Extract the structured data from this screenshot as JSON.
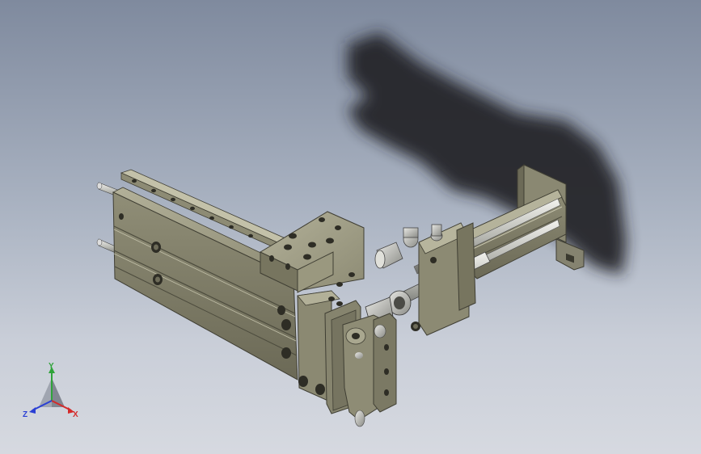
{
  "viewport": {
    "background_top": "#7f8a9e",
    "background_bottom": "#d6d9e0",
    "shadow_color": "#222428"
  },
  "model": {
    "body_color": "#8f8d76",
    "body_dark": "#5e5c4a",
    "body_light": "#b9b79f",
    "metal_color": "#c8c9c4"
  },
  "triad": {
    "x_label": "X",
    "y_label": "Y",
    "z_label": "Z",
    "x_color": "#d42a2a",
    "y_color": "#2fa33a",
    "z_color": "#2a3fd4"
  }
}
